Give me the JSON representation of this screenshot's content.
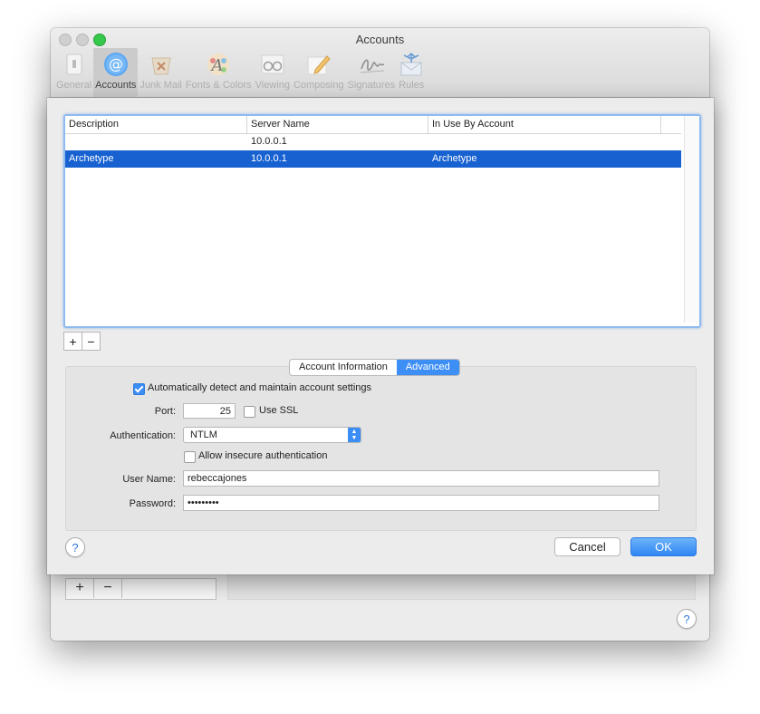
{
  "window": {
    "title": "Accounts"
  },
  "toolbar": {
    "items": [
      {
        "label": "General",
        "icon": "general-switch-icon"
      },
      {
        "label": "Accounts",
        "icon": "at-sign-icon",
        "active": true
      },
      {
        "label": "Junk Mail",
        "icon": "trash-bin-icon"
      },
      {
        "label": "Fonts & Colors",
        "icon": "font-palette-icon"
      },
      {
        "label": "Viewing",
        "icon": "glasses-icon"
      },
      {
        "label": "Composing",
        "icon": "pencil-icon"
      },
      {
        "label": "Signatures",
        "icon": "signature-icon"
      },
      {
        "label": "Rules",
        "icon": "envelope-arrows-icon"
      }
    ]
  },
  "table": {
    "columns": [
      "Description",
      "Server Name",
      "In Use By Account"
    ],
    "rows": [
      [
        "",
        "10.0.0.1",
        ""
      ],
      [
        "Archetype",
        "10.0.0.1",
        "Archetype"
      ]
    ],
    "selected_row": 1
  },
  "list_buttons": {
    "add": "+",
    "remove": "−"
  },
  "tabs": [
    "Account Information",
    "Advanced"
  ],
  "advanced": {
    "auto_detect_label": "Automatically detect and maintain account settings",
    "auto_detect_checked": true,
    "port_label": "Port:",
    "port_value": "25",
    "ssl_label": "Use SSL",
    "ssl_checked": false,
    "auth_label": "Authentication:",
    "auth_value": "NTLM",
    "insecure_label": "Allow insecure authentication",
    "insecure_checked": false,
    "username_label": "User Name:",
    "username_value": "rebeccajones",
    "password_label": "Password:",
    "password_value": "•••••••••"
  },
  "buttons": {
    "help": "?",
    "cancel": "Cancel",
    "ok": "OK"
  },
  "colors": {
    "selection": "#1761d1",
    "accent": "#3b8ef5"
  }
}
